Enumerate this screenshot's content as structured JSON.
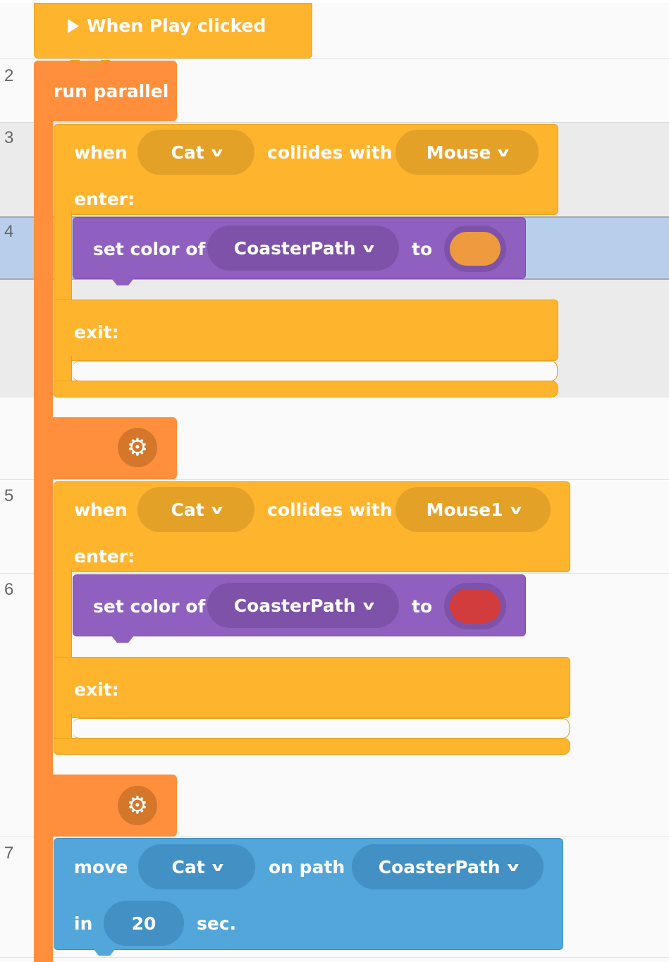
{
  "line_numbers": [
    "2",
    "3",
    "4",
    "5",
    "6",
    "7"
  ],
  "hat_block": {
    "icon": "play-icon",
    "label": "When Play clicked"
  },
  "run_parallel": {
    "label": "run parallel",
    "settings_icon": "gear-icon"
  },
  "collision_blocks": [
    {
      "when_label": "when",
      "object1": "Cat",
      "collides_label": "collides with",
      "object2": "Mouse",
      "enter_label": "enter:",
      "exit_label": "exit:",
      "action": {
        "label": "set color of",
        "target": "CoasterPath",
        "to_label": "to",
        "color": "#ee9a3e"
      }
    },
    {
      "when_label": "when",
      "object1": "Cat",
      "collides_label": "collides with",
      "object2": "Mouse1",
      "enter_label": "enter:",
      "exit_label": "exit:",
      "action": {
        "label": "set color of",
        "target": "CoasterPath",
        "to_label": "to",
        "color": "#d23c3c"
      }
    }
  ],
  "move_block": {
    "move_label": "move",
    "object": "Cat",
    "path_label": "on path",
    "path": "CoasterPath",
    "in_label": "in",
    "duration": "20",
    "unit_label": "sec."
  },
  "colors": {
    "event": "#ffb42e",
    "control": "#ff8f3c",
    "looks": "#9060c0",
    "motion": "#52a6da",
    "selected_row": "#b8cfec"
  }
}
